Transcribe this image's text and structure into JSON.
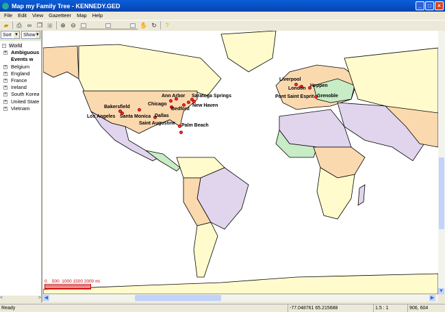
{
  "window": {
    "title": "Map my Family Tree - KENNEDY.GED"
  },
  "menu": [
    "File",
    "Edit",
    "View",
    "Gazetteer",
    "Map",
    "Help"
  ],
  "left": {
    "sort_label": "Sort",
    "show_label": "Show",
    "tree": {
      "root": "World",
      "items": [
        {
          "label": "Ambiguous",
          "bold": true
        },
        {
          "label": "Events w",
          "bold": true
        },
        {
          "label": "Belgium"
        },
        {
          "label": "England"
        },
        {
          "label": "France"
        },
        {
          "label": "Ireland"
        },
        {
          "label": "South Korea"
        },
        {
          "label": "United States"
        },
        {
          "label": "Vietnam"
        }
      ]
    }
  },
  "map": {
    "places": [
      "Liverpool",
      "London",
      "Heppen",
      "Pont Saint Esprit",
      "Grenoble",
      "Ann Arbor",
      "Saratoga Springs",
      "Chicago",
      "New Haven",
      "Bedford",
      "Bakersfield",
      "Los Angeles",
      "Santa Monica",
      "Dallas",
      "Saint Augustine",
      "Palm Beach"
    ],
    "scale_label": "0    500  1000 1500 2000 mi",
    "colors": {
      "ocean": "#ffffff",
      "peach": "#fbd9ae",
      "cream": "#fffbcc",
      "lilac": "#e0d5ec",
      "green": "#c7ecc6",
      "marker": "#ee3333"
    }
  },
  "status": {
    "text": "Ready",
    "coords": "-77.048761 65.215688",
    "zoom": "1.5 : 1",
    "pixel": "906, 604"
  }
}
